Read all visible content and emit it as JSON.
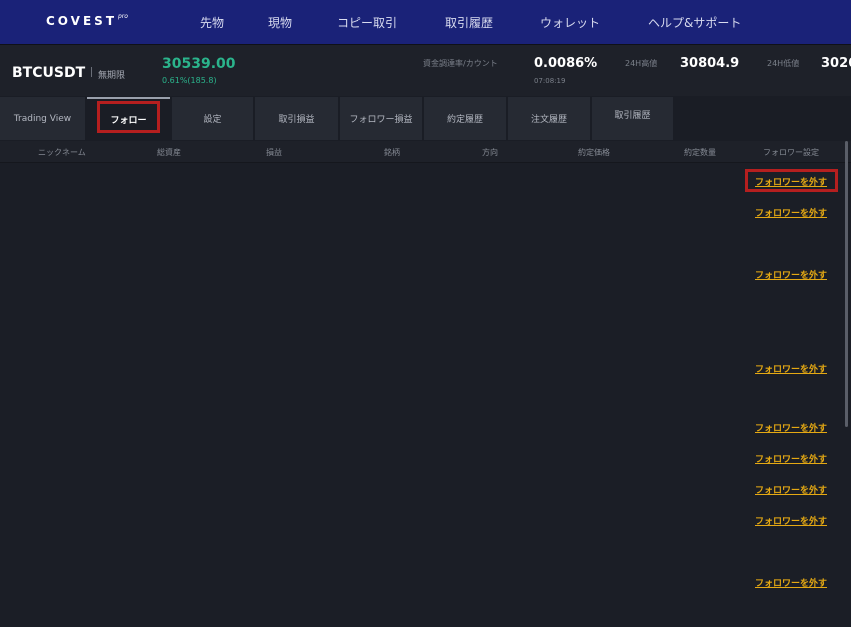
{
  "brand": {
    "logo_text": "COVEST",
    "logo_sup": "pro"
  },
  "nav": {
    "items": [
      {
        "label": "先物"
      },
      {
        "label": "現物"
      },
      {
        "label": "コピー取引"
      },
      {
        "label": "取引履歴"
      },
      {
        "label": "ウォレット"
      },
      {
        "label": "ヘルプ&サポート"
      }
    ]
  },
  "ticker": {
    "symbol": "BTCUSDT",
    "contract_type": "無期限",
    "price": "30539.00",
    "change": "0.61%(185.8)",
    "funding_label": "資金調達率/カウント",
    "funding_rate": "0.0086%",
    "countdown": "07:08:19",
    "high_label": "24H高値",
    "high_value": "30804.9",
    "low_label": "24H低値",
    "low_value": "3026"
  },
  "tabs": [
    {
      "label": "Trading View"
    },
    {
      "label": "フォロー"
    },
    {
      "label": "設定"
    },
    {
      "label": "取引損益"
    },
    {
      "label": "フォロワー損益"
    },
    {
      "label": "約定履歴"
    },
    {
      "label": "注文履歴"
    },
    {
      "label": "取引履歴"
    }
  ],
  "table": {
    "columns": [
      "ニックネーム",
      "総資産",
      "損益",
      "銘柄",
      "方向",
      "約定価格",
      "約定数量",
      "フォロワー設定"
    ],
    "rows": [
      {
        "action": "フォロワーを外す"
      },
      {
        "action": "フォロワーを外す"
      },
      {
        "action": "フォロワーを外す"
      },
      {
        "action": "フォロワーを外す"
      },
      {
        "action": "フォロワーを外す"
      },
      {
        "action": "フォロワーを外す"
      },
      {
        "action": "フォロワーを外す"
      },
      {
        "action": "フォロワーを外す"
      },
      {
        "action": "フォロワーを外す"
      }
    ]
  },
  "colors": {
    "nav_bg": "#1a2278",
    "price_up": "#2bb48c",
    "action_link": "#e5a913",
    "highlight": "#b51f1f"
  }
}
